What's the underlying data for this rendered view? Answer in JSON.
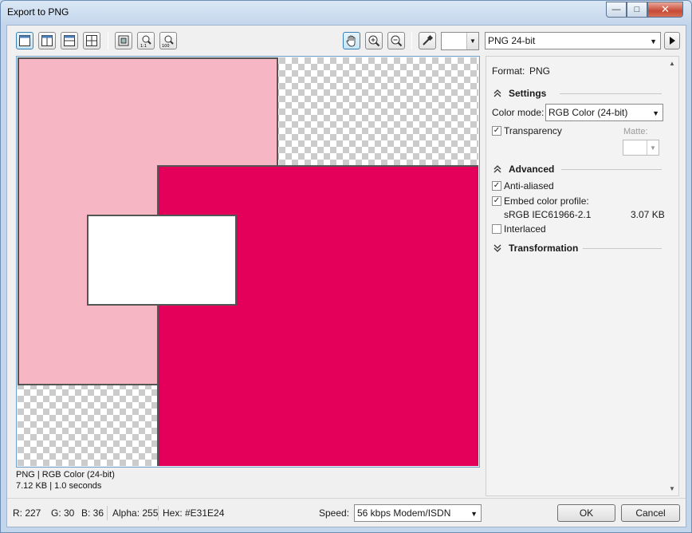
{
  "window": {
    "title": "Export to PNG"
  },
  "title_buttons": {
    "minimize": "—",
    "maximize": "□",
    "close": "✕"
  },
  "toolbar": {
    "color_swatch_value": "",
    "format_select": "PNG 24-bit",
    "icons": [
      "single-view-icon",
      "split-vertical-icon",
      "split-horizontal-icon",
      "quad-view-icon",
      "fit-icon",
      "zoom-1to1-icon",
      "zoom-100-icon",
      "hand-icon",
      "zoom-in-icon",
      "zoom-out-icon",
      "eyedropper-icon",
      "play-icon"
    ]
  },
  "preview": {
    "format_line": "PNG  |  RGB Color (24-bit)",
    "size_line": "7.12 KB  |  1.0 seconds",
    "colors": {
      "pink": "#F7B6C3",
      "magenta": "#E4005A",
      "white": "#FFFFFF"
    }
  },
  "panel": {
    "format_label": "Format:",
    "format_value": "PNG",
    "settings_title": "Settings",
    "color_mode_label": "Color mode:",
    "color_mode_value": "RGB Color (24-bit)",
    "transparency_label": "Transparency",
    "transparency_checked": true,
    "matte_label": "Matte:",
    "advanced_title": "Advanced",
    "anti_aliased_label": "Anti-aliased",
    "anti_aliased_checked": true,
    "embed_profile_label": "Embed color profile:",
    "embed_profile_checked": true,
    "profile_name": "sRGB IEC61966-2.1",
    "profile_size": "3.07 KB",
    "interlaced_label": "Interlaced",
    "interlaced_checked": false,
    "transformation_title": "Transformation"
  },
  "status": {
    "r": "R: 227",
    "g": "G: 30",
    "b": "B: 36",
    "alpha": "Alpha: 255",
    "hex": "Hex: #E31E24",
    "speed_label": "Speed:",
    "speed_value": "56 kbps Modem/ISDN"
  },
  "buttons": {
    "ok": "OK",
    "cancel": "Cancel"
  }
}
